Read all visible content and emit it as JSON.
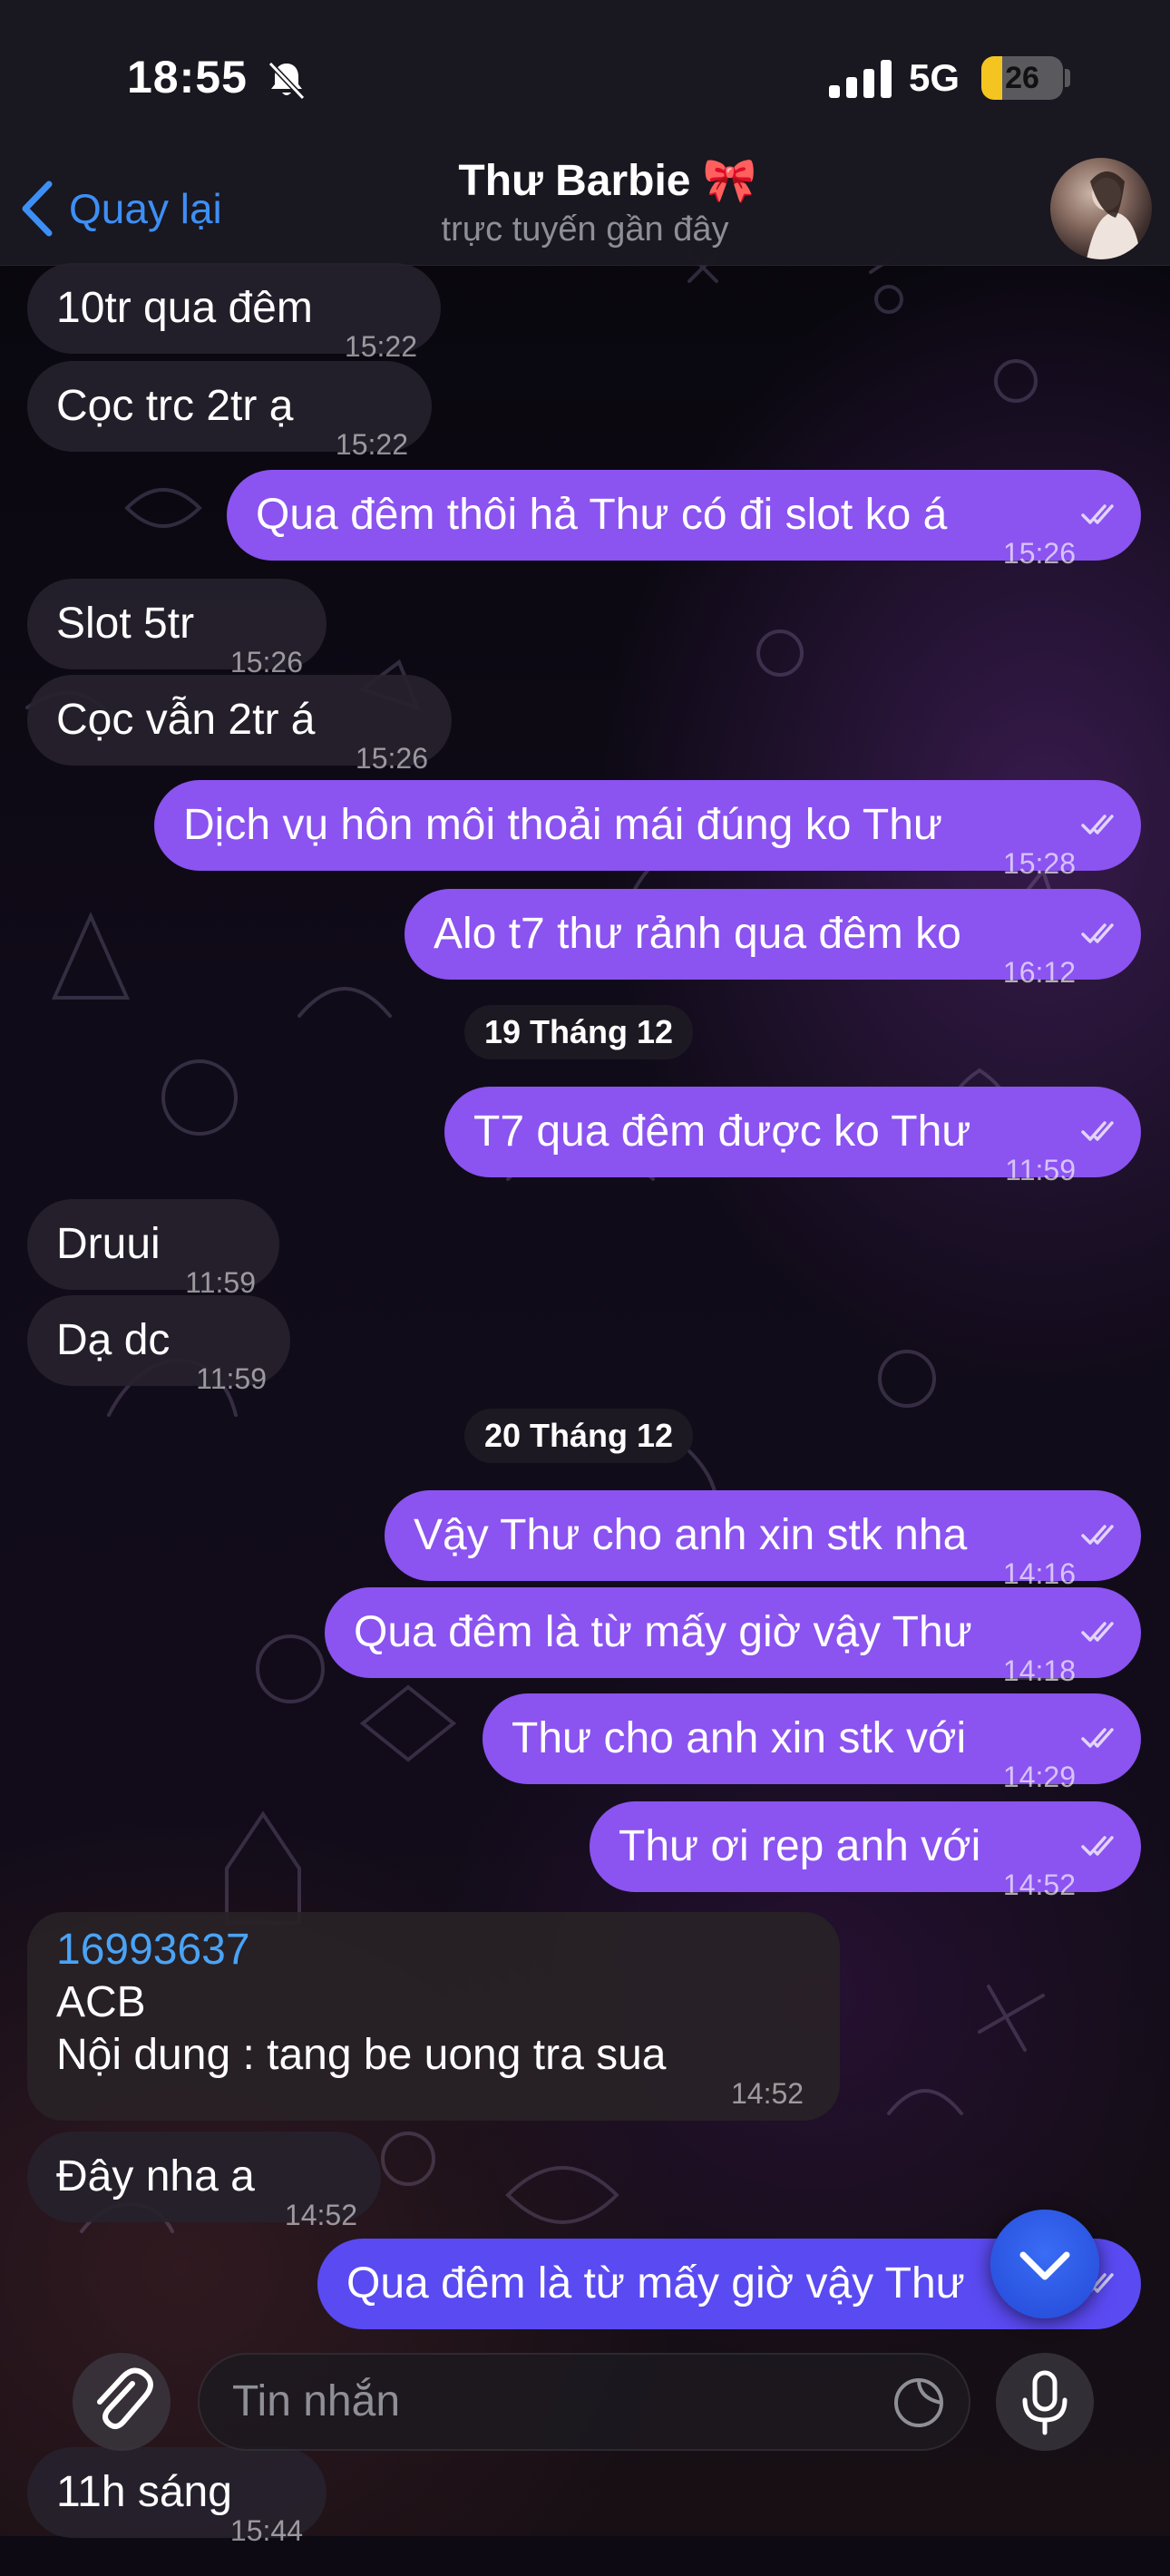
{
  "status_bar": {
    "time": "18:55",
    "network": "5G",
    "battery": "26",
    "battery_level_percent": 26
  },
  "header": {
    "back_label": "Quay lại",
    "title": "Thư Barbie 🎀",
    "status": "trực tuyến gần đây"
  },
  "messages": [
    {
      "dir": "in",
      "text": "10tr qua đêm",
      "time": "15:22"
    },
    {
      "dir": "in",
      "text": "Cọc trc 2tr ạ",
      "time": "15:22"
    },
    {
      "dir": "out",
      "text": "Qua đêm thôi hả Thư có đi slot ko á",
      "time": "15:26"
    },
    {
      "dir": "in",
      "text": "Slot 5tr",
      "time": "15:26"
    },
    {
      "dir": "in",
      "text": "Cọc vẫn 2tr á",
      "time": "15:26"
    },
    {
      "dir": "out",
      "text": "Dịch vụ hôn môi thoải mái đúng ko Thư",
      "time": "15:28"
    },
    {
      "dir": "out",
      "text": "Alo t7 thư rảnh qua đêm ko",
      "time": "16:12"
    },
    {
      "dir": "date",
      "text": "19 Tháng 12"
    },
    {
      "dir": "out",
      "text": "T7 qua đêm được ko Thư",
      "time": "11:59"
    },
    {
      "dir": "in",
      "text": "Druui",
      "time": "11:59"
    },
    {
      "dir": "in",
      "text": "Dạ dc",
      "time": "11:59"
    },
    {
      "dir": "date",
      "text": "20 Tháng 12"
    },
    {
      "dir": "out",
      "text": "Vậy Thư cho anh xin stk nha",
      "time": "14:16"
    },
    {
      "dir": "out",
      "text": "Qua đêm là từ mấy giờ vậy Thư",
      "time": "14:18"
    },
    {
      "dir": "out",
      "text": "Thư cho anh xin stk với",
      "time": "14:29"
    },
    {
      "dir": "out",
      "text": "Thư ơi rep anh với",
      "time": "14:52"
    },
    {
      "dir": "in",
      "lines": [
        "16993637",
        "ACB",
        " Nội dung : tang be uong tra sua"
      ],
      "time": "14:52"
    },
    {
      "dir": "in",
      "text": "Đây nha a",
      "time": "14:52"
    },
    {
      "dir": "out",
      "text": "Qua đêm là từ mấy giờ vậy Thư",
      "time": ""
    },
    {
      "dir": "in",
      "text": "11h sáng",
      "time": "15:44"
    }
  ],
  "input": {
    "placeholder": "Tin nhắn"
  },
  "colors": {
    "outgoing_bubble": "#8b53f0",
    "incoming_bubble": "#26222c",
    "accent": "#3d8ff5"
  }
}
